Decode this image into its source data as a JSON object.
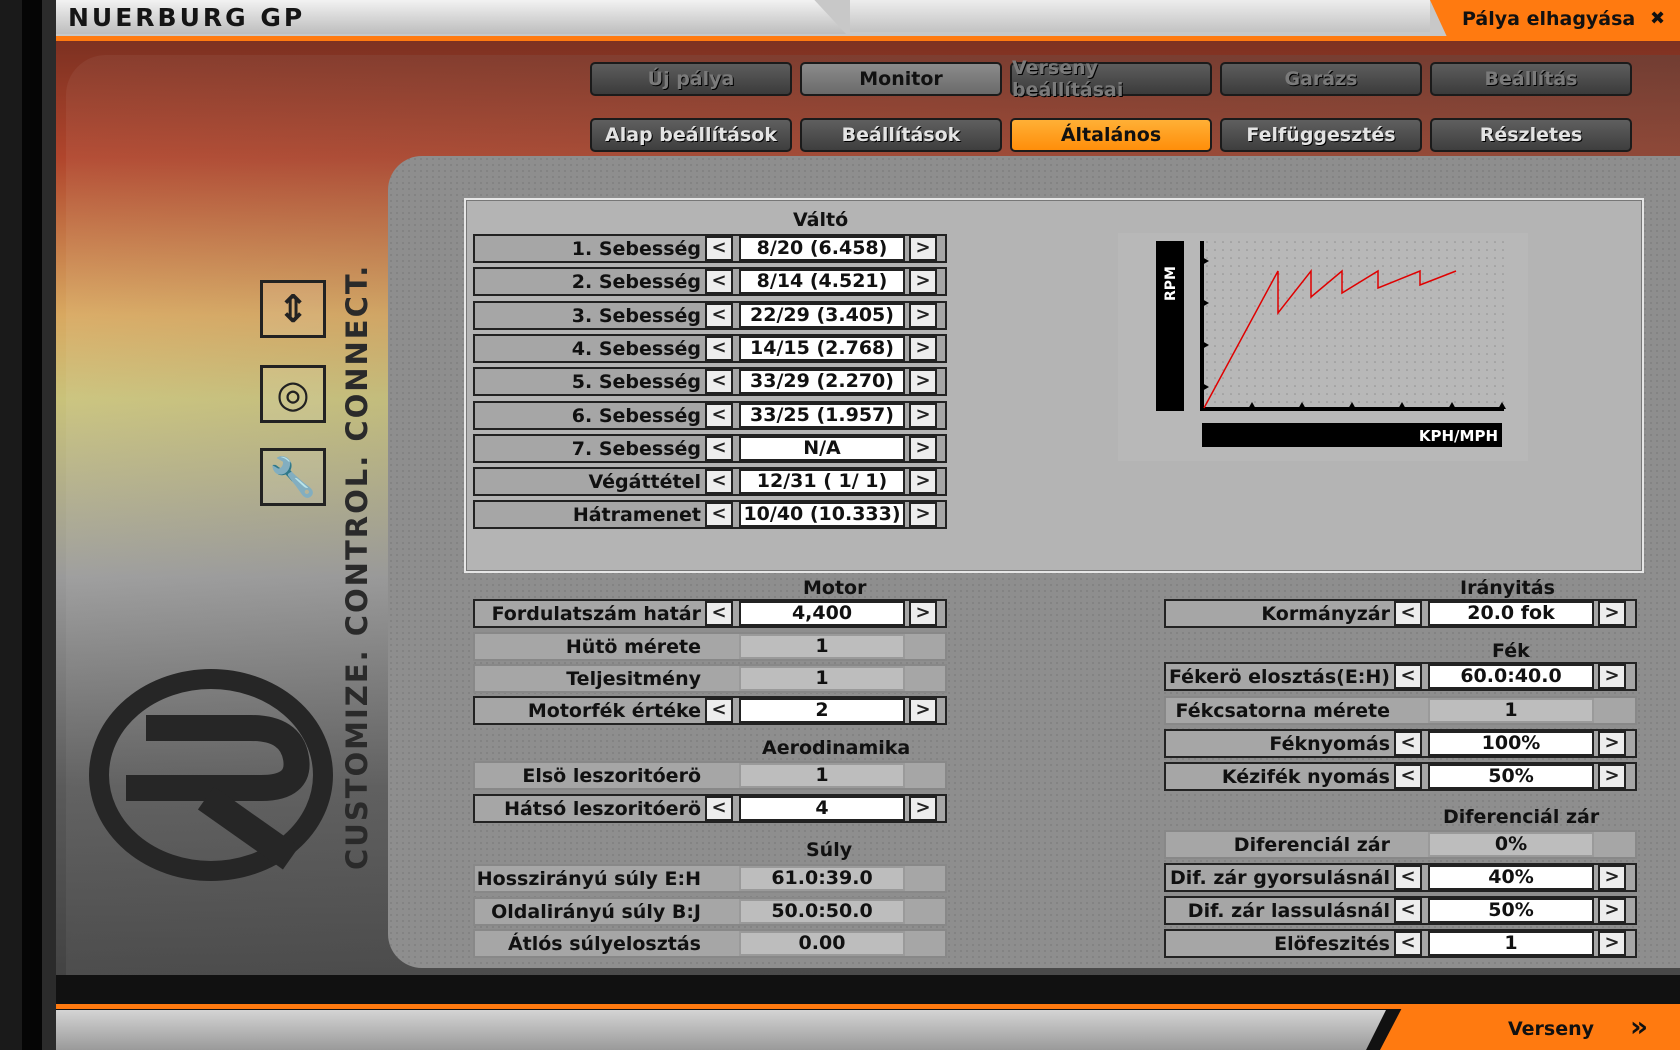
{
  "header": {
    "title": "NUERBURG GP",
    "exit_label": "Pálya elhagyása",
    "exit_icon": "close-icon"
  },
  "tabs_top": [
    {
      "label": "Új pálya",
      "state": "dim"
    },
    {
      "label": "Monitor",
      "state": "normal"
    },
    {
      "label": "Verseny beállításai",
      "state": "dim"
    },
    {
      "label": "Garázs",
      "state": "dim"
    },
    {
      "label": "Beállítás",
      "state": "dim"
    }
  ],
  "tabs_sub": [
    {
      "label": "Alap beállítások",
      "state": "normal"
    },
    {
      "label": "Beállítások",
      "state": "normal"
    },
    {
      "label": "Általános",
      "state": "active"
    },
    {
      "label": "Felfüggesztés",
      "state": "normal"
    },
    {
      "label": "Részletes",
      "state": "normal"
    }
  ],
  "gearbox": {
    "title": "Váltó",
    "rows": [
      {
        "label": "1. Sebesség",
        "value": "8/20 (6.458)"
      },
      {
        "label": "2. Sebesség",
        "value": "8/14 (4.521)"
      },
      {
        "label": "3. Sebesség",
        "value": "22/29 (3.405)"
      },
      {
        "label": "4. Sebesség",
        "value": "14/15 (2.768)"
      },
      {
        "label": "5. Sebesség",
        "value": "33/29 (2.270)"
      },
      {
        "label": "6. Sebesség",
        "value": "33/25 (1.957)"
      },
      {
        "label": "7. Sebesség",
        "value": "N/A"
      },
      {
        "label": "Végáttétel",
        "value": "12/31 (   1/ 1)"
      },
      {
        "label": "Hátramenet",
        "value": "10/40 (10.333)"
      }
    ],
    "graph_y_label": "RPM",
    "graph_x_label": "KPH/MPH"
  },
  "motor": {
    "title": "Motor",
    "rows": [
      {
        "label": "Fordulatszám határ",
        "value": "4,400",
        "editable": true
      },
      {
        "label": "Hütö mérete",
        "value": "1",
        "editable": false
      },
      {
        "label": "Teljesitmény",
        "value": "1",
        "editable": false
      },
      {
        "label": "Motorfék értéke",
        "value": "2",
        "editable": true
      }
    ]
  },
  "aero": {
    "title": "Aerodinamika",
    "rows": [
      {
        "label": "Elsö leszoritóerö",
        "value": "1",
        "editable": false
      },
      {
        "label": "Hátsó leszoritóerö",
        "value": "4",
        "editable": true
      }
    ]
  },
  "weight": {
    "title": "Súly",
    "rows": [
      {
        "label": "Hosszirányú súly E:H",
        "value": "61.0:39.0",
        "editable": false
      },
      {
        "label": "Oldalirányú súly B:J",
        "value": "50.0:50.0",
        "editable": false
      },
      {
        "label": "Átlós súlyelosztás",
        "value": "0.00",
        "editable": false
      }
    ]
  },
  "steering": {
    "title": "Irányitás",
    "rows": [
      {
        "label": "Kormányzár",
        "value": "20.0 fok",
        "editable": true
      }
    ]
  },
  "brake": {
    "title": "Fék",
    "rows": [
      {
        "label": "Fékerö elosztás(E:H)",
        "value": "60.0:40.0",
        "editable": true
      },
      {
        "label": "Fékcsatorna mérete",
        "value": "1",
        "editable": false
      },
      {
        "label": "Féknyomás",
        "value": "100%",
        "editable": true
      },
      {
        "label": "Kézifék nyomás",
        "value": "50%",
        "editable": true
      }
    ]
  },
  "diff": {
    "title": "Diferenciál zár",
    "rows": [
      {
        "label": "Diferenciál zár",
        "value": "0%",
        "editable": false
      },
      {
        "label": "Dif. zár gyorsulásnál",
        "value": "40%",
        "editable": true
      },
      {
        "label": "Dif. zár lassulásnál",
        "value": "50%",
        "editable": true
      },
      {
        "label": "Elöfeszités",
        "value": "1",
        "editable": true
      }
    ]
  },
  "side": {
    "slogan": "CUSTOMIZE. CONTROL. CONNECT.",
    "icons": [
      "compress-arrows-icon",
      "steering-wheel-icon",
      "wrench-icon"
    ]
  },
  "footer": {
    "race_label": "Verseny",
    "race_icon": "double-chevron-right-icon"
  },
  "arrows": {
    "left": "<",
    "right": ">"
  },
  "colors": {
    "accent": "#ff7a10",
    "active_tab": "#ff9a1a"
  }
}
